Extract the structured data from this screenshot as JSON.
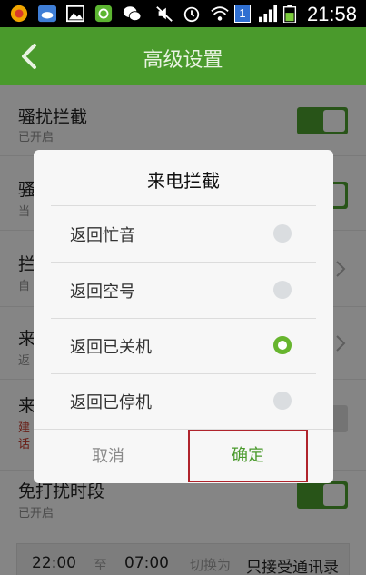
{
  "status_bar": {
    "time": "21:58",
    "sim_badge": "1",
    "icons": [
      "notification-app-icon",
      "cloud-app-icon",
      "gallery-icon",
      "wechat-moments-icon",
      "wechat-icon",
      "mute-icon",
      "alarm-icon",
      "wifi-icon",
      "sim-icon",
      "signal-icon",
      "battery-icon"
    ]
  },
  "header": {
    "title": "高级设置"
  },
  "settings": {
    "rows": [
      {
        "title": "骚扰拦截",
        "subtitle": "已开启"
      },
      {
        "title": "骚",
        "subtitle": "当"
      },
      {
        "title": "拦",
        "subtitle": "自"
      },
      {
        "title": "来",
        "subtitle": "返"
      },
      {
        "title": "来",
        "subtitle_line1": "建",
        "subtitle_line2": "话"
      },
      {
        "title": "免打扰时段",
        "subtitle": "已开启"
      }
    ],
    "bottom_bar": {
      "start": "22:00",
      "to": "至",
      "end": "07:00",
      "switch": "切换为",
      "mode": "只接受通讯录"
    }
  },
  "dialog": {
    "title": "来电拦截",
    "options": [
      {
        "label": "返回忙音",
        "selected": false
      },
      {
        "label": "返回空号",
        "selected": false
      },
      {
        "label": "返回已关机",
        "selected": true
      },
      {
        "label": "返回已停机",
        "selected": false
      }
    ],
    "cancel_label": "取消",
    "ok_label": "确定"
  },
  "colors": {
    "accent": "#4a9a2c",
    "radio_on": "#67b52e",
    "highlight_box": "#b0242c"
  }
}
